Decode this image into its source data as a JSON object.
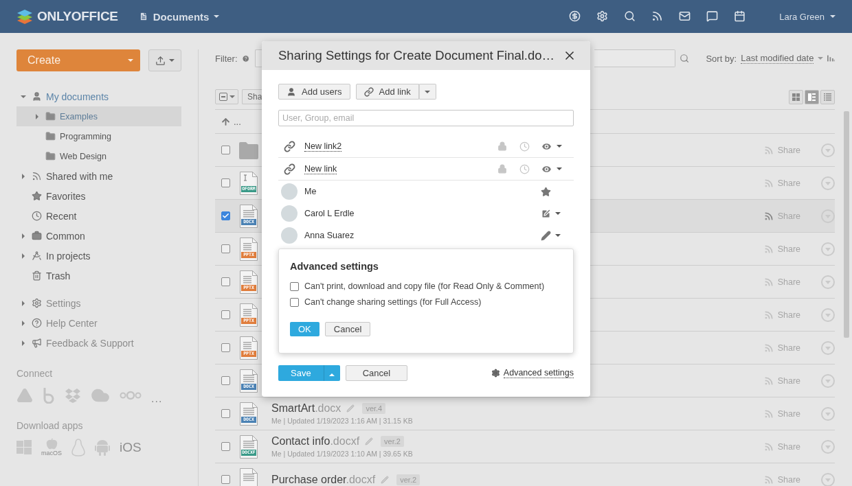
{
  "header": {
    "logo": "ONLYOFFICE",
    "module": "Documents",
    "user": "Lara Green"
  },
  "sidebar": {
    "create": "Create",
    "tree": [
      {
        "label": "My documents",
        "kind": "user",
        "expanded": true,
        "selected": false,
        "children": [
          {
            "label": "Examples",
            "kind": "folder",
            "expanded": false,
            "selected": true
          },
          {
            "label": "Programming",
            "kind": "folder",
            "selected": false
          },
          {
            "label": "Web Design",
            "kind": "folder",
            "selected": false
          }
        ]
      },
      {
        "label": "Shared with me",
        "kind": "shared",
        "expanded": false,
        "selected": false
      },
      {
        "label": "Favorites",
        "kind": "star",
        "selected": false
      },
      {
        "label": "Recent",
        "kind": "clock",
        "selected": false
      },
      {
        "label": "Common",
        "kind": "briefcase",
        "expanded": false,
        "selected": false
      },
      {
        "label": "In projects",
        "kind": "projects",
        "expanded": false,
        "selected": false
      },
      {
        "label": "Trash",
        "kind": "trash",
        "selected": false
      }
    ],
    "extra": [
      {
        "label": "Settings",
        "kind": "gear",
        "expanded": false
      },
      {
        "label": "Help Center",
        "kind": "help",
        "expanded": false
      },
      {
        "label": "Feedback & Support",
        "kind": "megaphone",
        "expanded": false
      }
    ],
    "connect": {
      "title": "Connect",
      "more": "..."
    },
    "apps": {
      "title": "Download apps",
      "macos": "macOS",
      "ios": "iOS"
    }
  },
  "main": {
    "filter_label": "Filter:",
    "sort_label": "Sort by:",
    "sort_value": "Last modified date",
    "toolbar_button": "Sha",
    "up_label": "...",
    "views": [
      {
        "kind": "tiles",
        "selected": false
      },
      {
        "kind": "compact",
        "selected": true
      },
      {
        "kind": "list",
        "selected": false
      }
    ],
    "files": [
      {
        "kind": "folder",
        "checked": false,
        "share": "Share"
      },
      {
        "kind": "oform",
        "type_label": "OFORM",
        "checked": false,
        "share": "Share"
      },
      {
        "kind": "docx",
        "type_label": "DOCX",
        "checked": true,
        "share": "Share"
      },
      {
        "kind": "pptx",
        "type_label": "PPTX",
        "checked": false,
        "share": "Share"
      },
      {
        "kind": "pptx",
        "type_label": "PPTX",
        "checked": false,
        "share": "Share"
      },
      {
        "kind": "pptx",
        "type_label": "PPTX",
        "checked": false,
        "share": "Share"
      },
      {
        "kind": "pptx",
        "type_label": "PPTX",
        "checked": false,
        "share": "Share"
      },
      {
        "kind": "docx",
        "type_label": "DOCX",
        "checked": false,
        "share": "Share"
      },
      {
        "kind": "docx",
        "type_label": "DOCX",
        "checked": false,
        "name": "SmartArt",
        "ext": ".docx",
        "version": "ver.4",
        "meta": "Me | Updated 1/19/2023 1:16 AM | 31.15 KB",
        "share": "Share"
      },
      {
        "kind": "docxf",
        "type_label": "DOCXF",
        "checked": false,
        "name": "Contact info",
        "ext": ".docxf",
        "version": "ver.2",
        "meta": "Me | Updated 1/19/2023 1:10 AM | 39.65 KB",
        "share": "Share"
      },
      {
        "kind": "docxf",
        "checked": false,
        "name": "Purchase order",
        "ext": ".docxf",
        "version": "ver.2",
        "share": "Share"
      }
    ]
  },
  "dialog": {
    "title": "Sharing Settings for Create Document Final.do…",
    "add_users": "Add users",
    "add_link": "Add link",
    "search_placeholder": "User, Group, email",
    "entries": [
      {
        "kind": "link",
        "name": "New link2",
        "access": {
          "kind": "read"
        }
      },
      {
        "kind": "link",
        "name": "New link",
        "access": {
          "kind": "read"
        }
      },
      {
        "kind": "user",
        "name": "Me",
        "access": {
          "kind": "owner"
        }
      },
      {
        "kind": "user",
        "name": "Carol L Erdle",
        "access": {
          "kind": "review"
        }
      },
      {
        "kind": "user",
        "name": "Anna Suarez",
        "access": {
          "kind": "edit"
        }
      }
    ],
    "advanced": {
      "title": "Advanced settings",
      "options": [
        {
          "label": "Can't print, download and copy file (for Read Only & Comment)",
          "checked": false
        },
        {
          "label": "Can't change sharing settings (for Full Access)",
          "checked": false
        }
      ],
      "ok": "OK",
      "cancel": "Cancel"
    },
    "save": "Save",
    "cancel": "Cancel",
    "advanced_link": "Advanced settings"
  }
}
